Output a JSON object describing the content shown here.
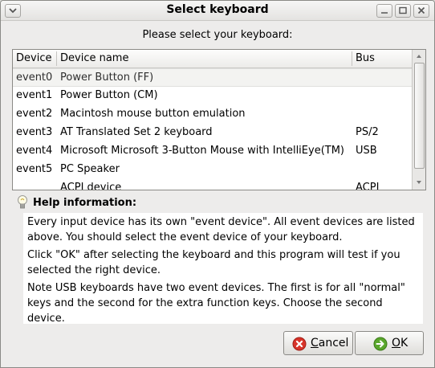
{
  "window": {
    "title": "Select keyboard"
  },
  "prompt": "Please select your keyboard:",
  "table": {
    "headers": [
      "Device",
      "Device name",
      "Bus"
    ],
    "rows": [
      {
        "device": "event0",
        "name": "Power Button (FF)",
        "bus": ""
      },
      {
        "device": "event1",
        "name": "Power Button (CM)",
        "bus": ""
      },
      {
        "device": "event2",
        "name": "Macintosh mouse button emulation",
        "bus": ""
      },
      {
        "device": "event3",
        "name": "AT Translated Set 2 keyboard",
        "bus": "PS/2"
      },
      {
        "device": "event4",
        "name": "Microsoft Microsoft 3-Button Mouse with IntelliEye(TM)",
        "bus": "USB"
      },
      {
        "device": "event5",
        "name": "PC Speaker",
        "bus": ""
      },
      {
        "device": "",
        "name": "ACPI device",
        "bus": "ACPI"
      }
    ]
  },
  "help": {
    "title": "Help information:",
    "paragraphs": [
      "Every input device has its own \"event device\". All event devices are listed above. You should select the event device of your keyboard.",
      "Click \"OK\" after selecting the keyboard and this program will test if you selected the right device.",
      "Note USB keyboards have two event devices. The first is for all \"normal\" keys and the second for the extra function keys. Choose the second device."
    ]
  },
  "buttons": {
    "cancel_mnemonic": "C",
    "cancel_rest": "ancel",
    "ok_mnemonic": "O",
    "ok_rest": "K"
  },
  "colors": {
    "cancel_icon": "#d8342a",
    "ok_icon": "#5aa72c"
  }
}
